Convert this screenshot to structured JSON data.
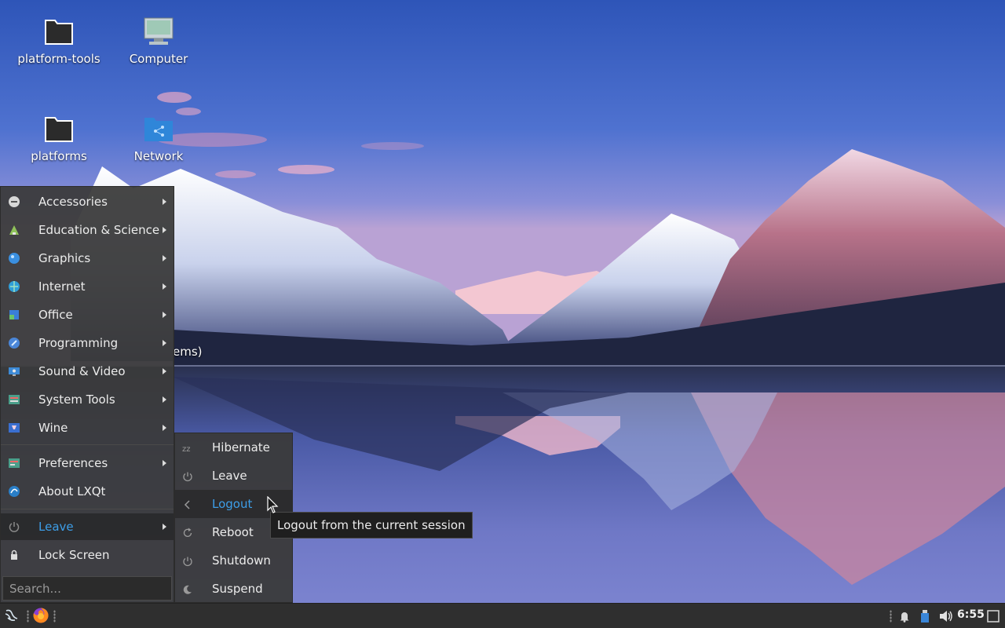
{
  "desktop": {
    "icons": [
      {
        "label": "platform-tools"
      },
      {
        "label": "Computer"
      },
      {
        "label": "platforms"
      },
      {
        "label": "Network"
      }
    ],
    "partially_hidden_label": "ems)"
  },
  "main_menu": {
    "items": [
      {
        "label": "Accessories",
        "icon": "accessories-icon",
        "submenu": true
      },
      {
        "label": "Education & Science",
        "icon": "education-icon",
        "submenu": true
      },
      {
        "label": "Graphics",
        "icon": "graphics-icon",
        "submenu": true
      },
      {
        "label": "Internet",
        "icon": "internet-icon",
        "submenu": true
      },
      {
        "label": "Office",
        "icon": "office-icon",
        "submenu": true
      },
      {
        "label": "Programming",
        "icon": "programming-icon",
        "submenu": true
      },
      {
        "label": "Sound & Video",
        "icon": "sound-video-icon",
        "submenu": true
      },
      {
        "label": "System Tools",
        "icon": "system-tools-icon",
        "submenu": true
      },
      {
        "label": "Wine",
        "icon": "wine-icon",
        "submenu": true
      },
      {
        "label": "Preferences",
        "icon": "preferences-icon",
        "submenu": true
      },
      {
        "label": "About LXQt",
        "icon": "lxqt-icon",
        "submenu": false
      },
      {
        "label": "Leave",
        "icon": "power-icon",
        "submenu": true,
        "active": true
      },
      {
        "label": "Lock Screen",
        "icon": "lock-icon",
        "submenu": false
      }
    ],
    "search_placeholder": "Search..."
  },
  "leave_menu": {
    "items": [
      {
        "label": "Hibernate",
        "icon": "hibernate-icon"
      },
      {
        "label": "Leave",
        "icon": "power-icon"
      },
      {
        "label": "Logout",
        "icon": "logout-icon",
        "hover": true
      },
      {
        "label": "Reboot",
        "icon": "reboot-icon"
      },
      {
        "label": "Shutdown",
        "icon": "shutdown-icon"
      },
      {
        "label": "Suspend",
        "icon": "suspend-icon"
      }
    ]
  },
  "tooltip": {
    "text": "Logout from the current session"
  },
  "taskbar": {
    "clock": "6:55",
    "icons": [
      "start-menu-icon",
      "firefox-icon",
      "notification-bell-icon",
      "usb-drive-icon",
      "volume-icon",
      "show-desktop-icon"
    ]
  },
  "colors": {
    "accent": "#3d9ee8",
    "menu_bg": "#3a3a3a",
    "taskbar_bg": "#2f2f2f"
  }
}
